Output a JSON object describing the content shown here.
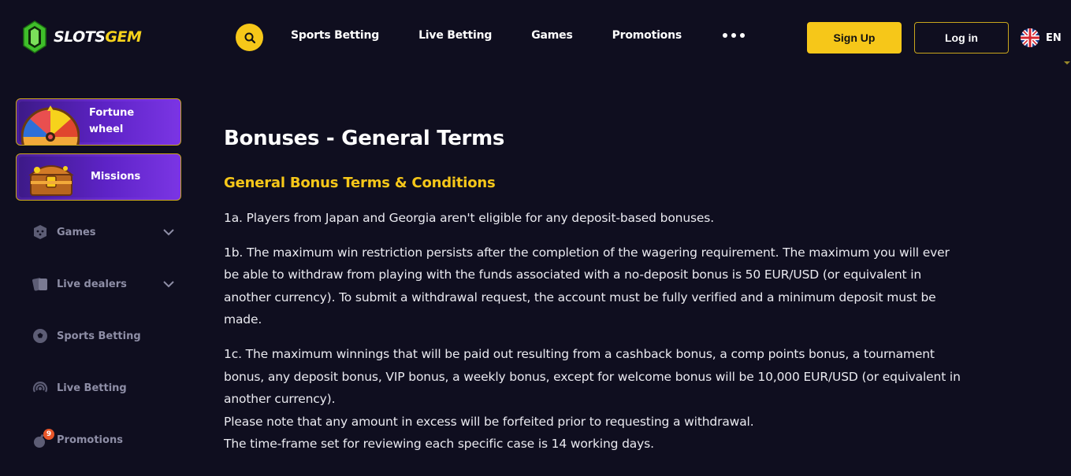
{
  "header": {
    "logo_text_white": "SLOTS",
    "logo_text_yellow": "GEM",
    "nav": [
      "Sports Betting",
      "Live Betting",
      "Games",
      "Promotions"
    ],
    "signup_label": "Sign Up",
    "login_label": "Log in",
    "language_code": "EN"
  },
  "sidebar": {
    "promo_cards": [
      {
        "label_line1": "Fortune",
        "label_line2": "wheel"
      },
      {
        "label": "Missions"
      }
    ],
    "items": [
      {
        "label": "Games",
        "icon": "dice-icon",
        "expandable": true
      },
      {
        "label": "Live dealers",
        "icon": "cards-icon",
        "expandable": true
      },
      {
        "label": "Sports Betting",
        "icon": "soccer-ball-icon",
        "expandable": false
      },
      {
        "label": "Live Betting",
        "icon": "broadcast-icon",
        "expandable": false
      },
      {
        "label": "Promotions",
        "icon": "bomb-icon",
        "expandable": false,
        "badge": "9"
      }
    ]
  },
  "main": {
    "title": "Bonuses - General Terms",
    "section_title": "General Bonus Terms & Conditions",
    "p1": "1a. Players from Japan and Georgia aren't eligible for any deposit-based bonuses.",
    "p2": "1b. The maximum win restriction persists after the completion of the wagering requirement. The maximum you will ever be able to withdraw from playing with the funds associated with a no-deposit bonus is 50 EUR/USD (or equivalent in another currency). To submit a withdrawal request, the account must be fully verified and a minimum deposit must be made.",
    "p3_lines": [
      "1c. The maximum winnings that will be paid out resulting from a cashback bonus, a comp points bonus, a tournament bonus, any deposit bonus, VIP bonus, a weekly bonus, except for welcome bonus will be 10,000 EUR/USD (or equivalent in another currency).",
      "Please note that any amount in excess will be forfeited prior to requesting a withdrawal.",
      "The time-frame set for reviewing each specific case is 14 working days."
    ]
  },
  "colors": {
    "background": "#0f0e1f",
    "accent_yellow": "#f6c719",
    "sidebar_text": "#8e8ea6",
    "promo_purple": "#6b2bd6"
  }
}
